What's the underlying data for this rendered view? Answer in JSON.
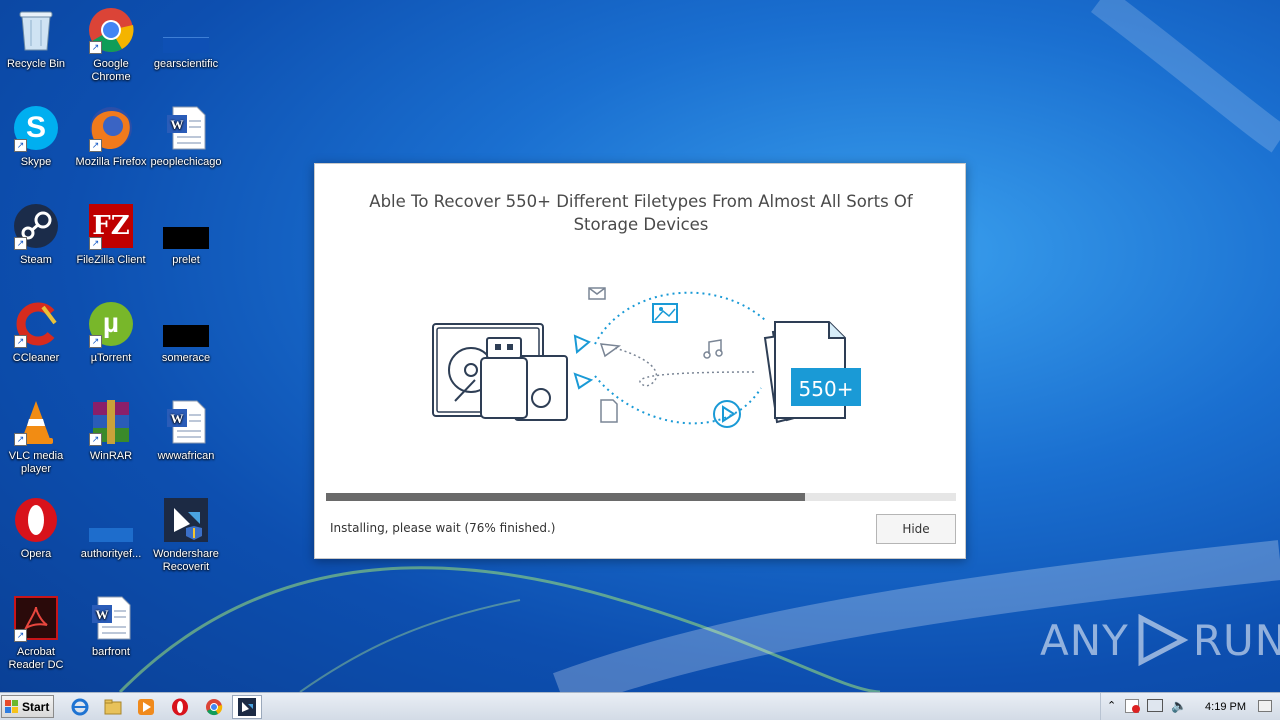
{
  "desktop": {
    "icons": [
      {
        "label": "Recycle Bin"
      },
      {
        "label": "Google Chrome"
      },
      {
        "label": "gearscientific"
      },
      {
        "label": "Skype"
      },
      {
        "label": "Mozilla Firefox"
      },
      {
        "label": "peoplechicago"
      },
      {
        "label": "Steam"
      },
      {
        "label": "FileZilla Client"
      },
      {
        "label": "prelet"
      },
      {
        "label": "CCleaner"
      },
      {
        "label": "µTorrent"
      },
      {
        "label": "somerace"
      },
      {
        "label": "VLC media player"
      },
      {
        "label": "WinRAR"
      },
      {
        "label": "wwwafrican"
      },
      {
        "label": "Opera"
      },
      {
        "label": "authorityef..."
      },
      {
        "label": "Wondershare Recoverit"
      },
      {
        "label": "Acrobat Reader DC"
      },
      {
        "label": "barfront"
      }
    ]
  },
  "installer": {
    "headline": "Able To Recover 550+ Different Filetypes From Almost All Sorts Of Storage Devices",
    "badge": "550+",
    "progress_fraction": 0.76,
    "status": "Installing, please wait (76% finished.)",
    "hide_label": "Hide",
    "accent_color": "#1a9ad6"
  },
  "taskbar": {
    "start_label": "Start",
    "clock": "4:19 PM"
  },
  "watermark": {
    "left": "ANY",
    "right": "RUN"
  }
}
